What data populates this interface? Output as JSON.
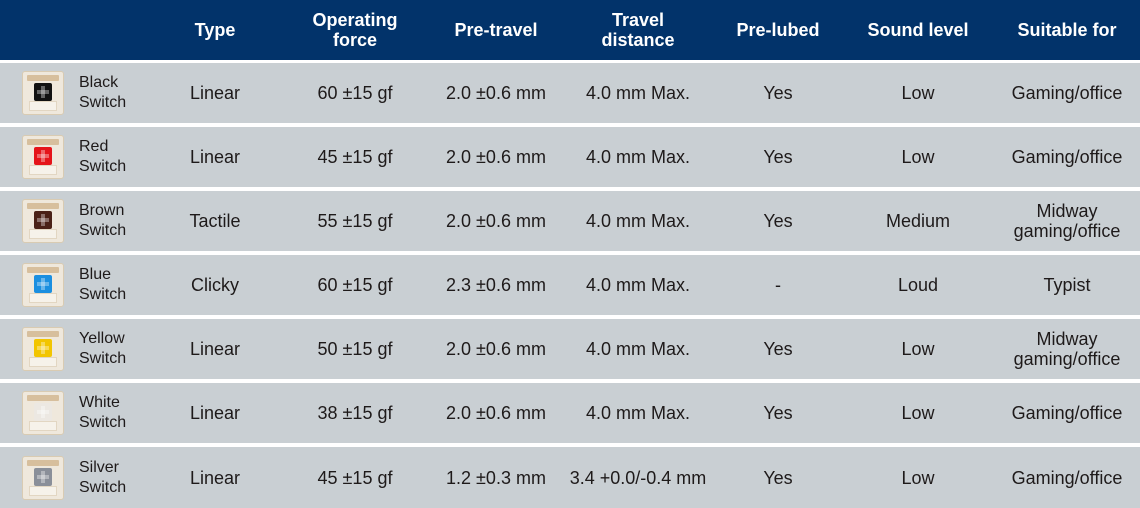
{
  "headers": [
    "",
    "Type",
    "Operating\nforce",
    "Pre-travel",
    "Travel\ndistance",
    "Pre-lubed",
    "Sound level",
    "Suitable for"
  ],
  "header_lines": {
    "type": "Type",
    "operating_force": [
      "Operating",
      "force"
    ],
    "pre_travel": "Pre-travel",
    "travel_distance": [
      "Travel",
      "distance"
    ],
    "pre_lubed": "Pre-lubed",
    "sound_level": "Sound level",
    "suitable_for": "Suitable for"
  },
  "colors": {
    "header_bg": "#02336a",
    "row_bg": "#c9cfd3",
    "text": "#1e1a1a"
  },
  "rows": [
    {
      "name": [
        "Black",
        "Switch"
      ],
      "icon": "black-switch-icon",
      "stem_color": "#111111",
      "type": "Linear",
      "force": "60 ±15 gf",
      "pre_travel": "2.0 ±0.6 mm",
      "travel": "4.0 mm Max.",
      "pre_lubed": "Yes",
      "sound": "Low",
      "suitable": [
        "Gaming/office"
      ]
    },
    {
      "name": [
        "Red",
        "Switch"
      ],
      "icon": "red-switch-icon",
      "stem_color": "#e5141a",
      "type": "Linear",
      "force": "45 ±15 gf",
      "pre_travel": "2.0 ±0.6 mm",
      "travel": "4.0 mm Max.",
      "pre_lubed": "Yes",
      "sound": "Low",
      "suitable": [
        "Gaming/office"
      ]
    },
    {
      "name": [
        "Brown",
        "Switch"
      ],
      "icon": "brown-switch-icon",
      "stem_color": "#4a2117",
      "type": "Tactile",
      "force": "55 ±15 gf",
      "pre_travel": "2.0 ±0.6 mm",
      "travel": "4.0 mm Max.",
      "pre_lubed": "Yes",
      "sound": "Medium",
      "suitable": [
        "Midway",
        "gaming/office"
      ]
    },
    {
      "name": [
        "Blue",
        "Switch"
      ],
      "icon": "blue-switch-icon",
      "stem_color": "#1b8fe0",
      "type": "Clicky",
      "force": "60 ±15 gf",
      "pre_travel": "2.3 ±0.6 mm",
      "travel": "4.0 mm Max.",
      "pre_lubed": "-",
      "sound": "Loud",
      "suitable": [
        "Typist"
      ]
    },
    {
      "name": [
        "Yellow",
        "Switch"
      ],
      "icon": "yellow-switch-icon",
      "stem_color": "#f2c500",
      "type": "Linear",
      "force": "50 ±15 gf",
      "pre_travel": "2.0 ±0.6 mm",
      "travel": "4.0 mm Max.",
      "pre_lubed": "Yes",
      "sound": "Low",
      "suitable": [
        "Midway",
        "gaming/office"
      ]
    },
    {
      "name": [
        "White",
        "Switch"
      ],
      "icon": "white-switch-icon",
      "stem_color": "#ece8e2",
      "type": "Linear",
      "force": "38 ±15 gf",
      "pre_travel": "2.0 ±0.6 mm",
      "travel": "4.0 mm Max.",
      "pre_lubed": "Yes",
      "sound": "Low",
      "suitable": [
        "Gaming/office"
      ]
    },
    {
      "name": [
        "Silver",
        "Switch"
      ],
      "icon": "silver-switch-icon",
      "stem_color": "#8a8f99",
      "type": "Linear",
      "force": "45 ±15 gf",
      "pre_travel": "1.2 ±0.3 mm",
      "travel": "3.4 +0.0/-0.4 mm",
      "pre_lubed": "Yes",
      "sound": "Low",
      "suitable": [
        "Gaming/office"
      ]
    }
  ]
}
